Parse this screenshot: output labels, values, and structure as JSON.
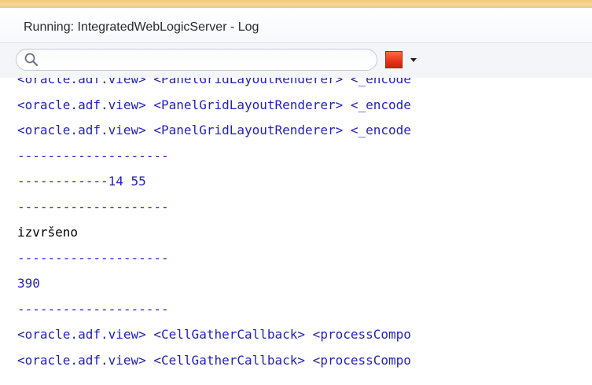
{
  "window": {
    "title": "Running: IntegratedWebLogicServer - Log"
  },
  "toolbar": {
    "search_value": "",
    "search_placeholder": "",
    "search_icon": "search-icon",
    "stop_icon": "stop-icon",
    "stop_color": "#e8321a",
    "dropdown_icon": "chevron-down-icon"
  },
  "log": {
    "colors": {
      "blue": "#2222bb",
      "black": "#000000"
    },
    "lines": [
      {
        "text": "<oracle.adf.view> <PanelGridLayoutRenderer> <_encode",
        "color": "blue",
        "partial": true
      },
      {
        "text": "<oracle.adf.view> <PanelGridLayoutRenderer> <_encode",
        "color": "blue"
      },
      {
        "text": "<oracle.adf.view> <PanelGridLayoutRenderer> <_encode",
        "color": "blue"
      },
      {
        "text": "--------------------",
        "color": "blue"
      },
      {
        "text": "------------14 55",
        "color": "blue"
      },
      {
        "text": "--------------------",
        "color": "blue"
      },
      {
        "text": "izvršeno",
        "color": "black"
      },
      {
        "text": "--------------------",
        "color": "blue"
      },
      {
        "text": "390",
        "color": "blue"
      },
      {
        "text": "--------------------",
        "color": "blue"
      },
      {
        "text": "<oracle.adf.view> <CellGatherCallback> <processCompo",
        "color": "blue"
      },
      {
        "text": "<oracle.adf.view> <CellGatherCallback> <processCompo",
        "color": "blue"
      }
    ]
  }
}
